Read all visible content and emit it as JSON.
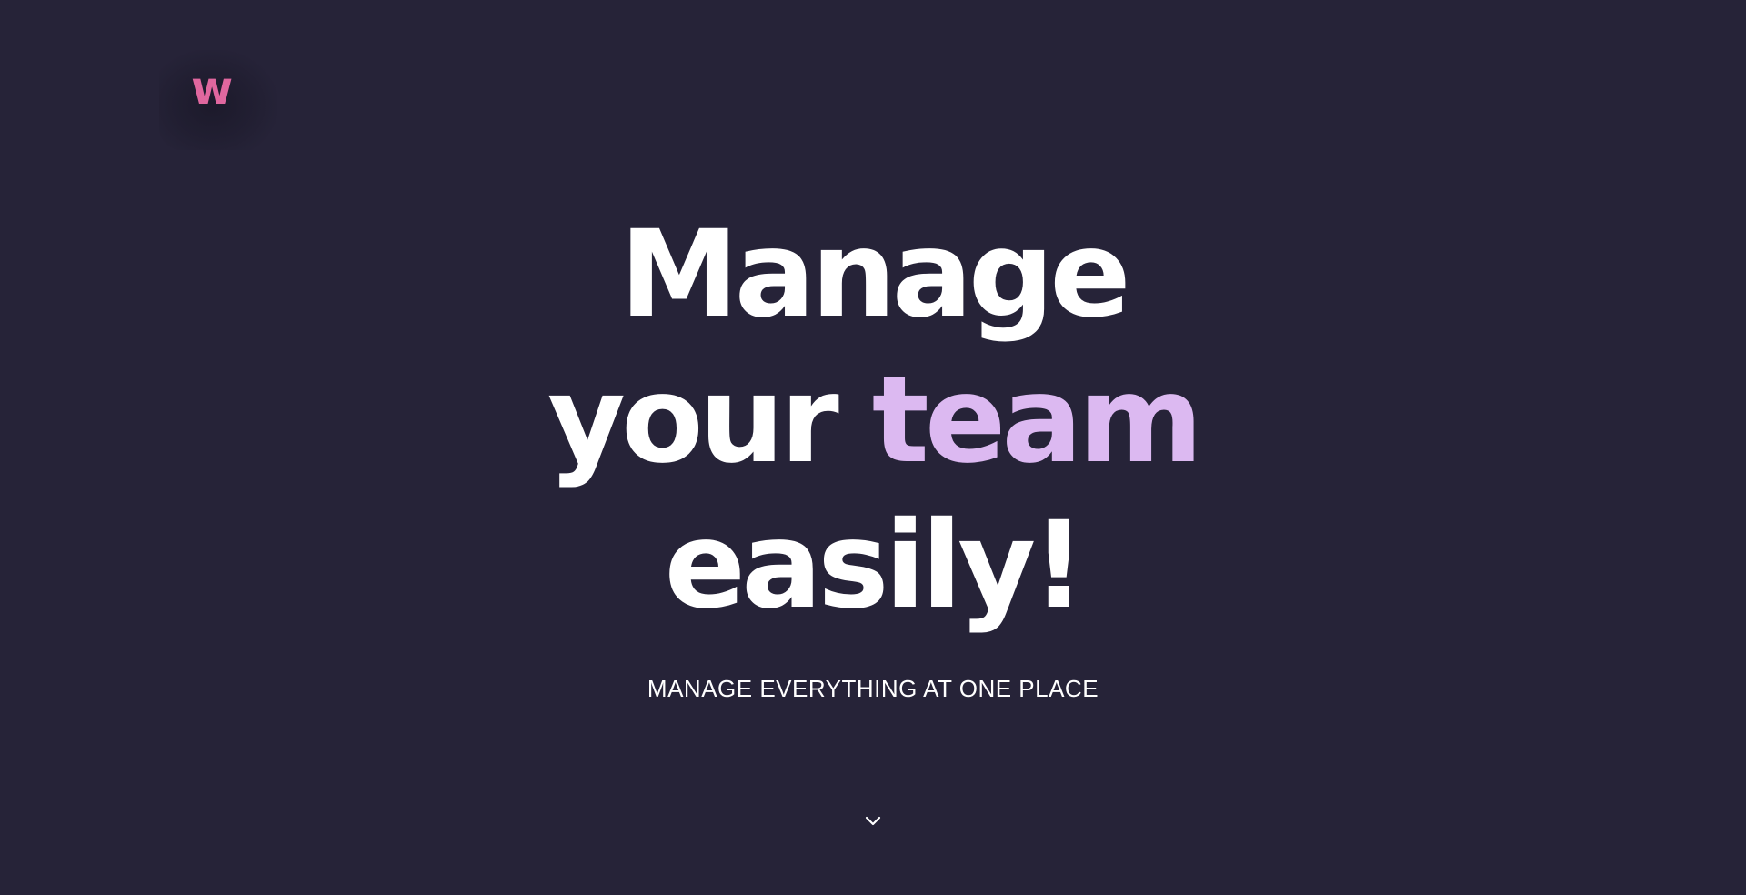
{
  "brand": {
    "logo_text": "w",
    "logo_color": "#e0679f"
  },
  "hero": {
    "headline_line1": "Manage",
    "headline_line2_start": "your ",
    "headline_line2_accent": "team",
    "headline_line3": "easily!",
    "accent_color": "#dcb9f1",
    "subtitle": "MANAGE EVERYTHING AT ONE PLACE"
  },
  "scroll": {
    "icon": "chevron-down-icon"
  },
  "theme": {
    "background": "#262338",
    "text": "#ffffff"
  }
}
